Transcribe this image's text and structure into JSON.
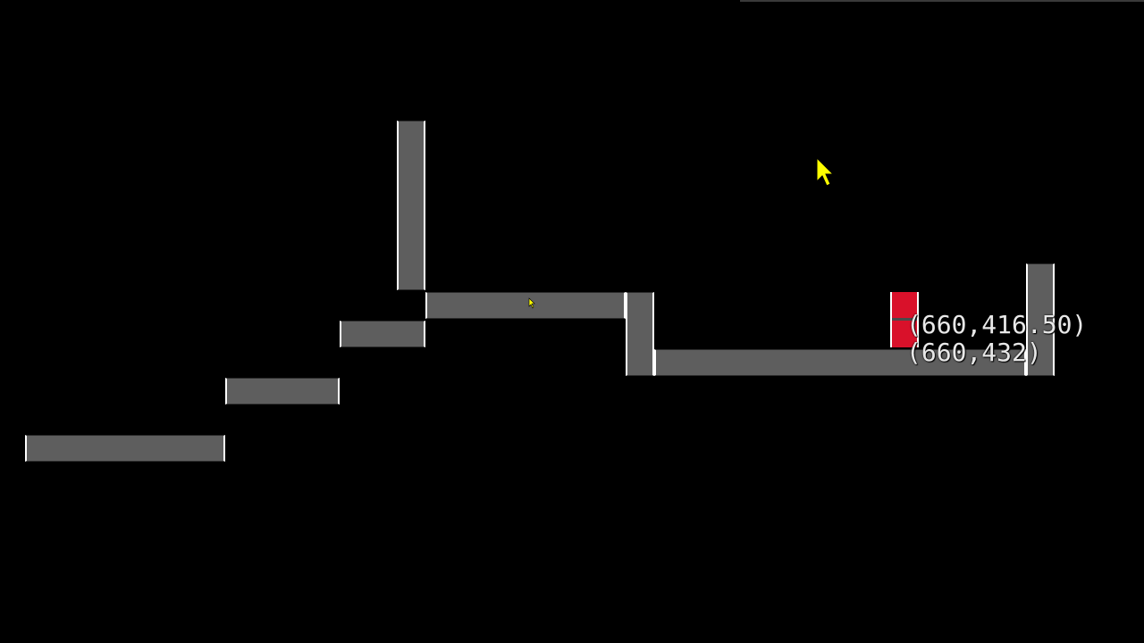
{
  "colors": {
    "background": "#000000",
    "block_fill": "#5e5e5e",
    "block_edge": "#ffffff",
    "player_fill": "#d9112a",
    "cursor": "#ffff00",
    "coord_text": "#e8e8e8"
  },
  "hud": {
    "coord_primary": "(660,416.50)",
    "coord_secondary": "(660,432)"
  },
  "icons": {
    "mouse_cursor": "arrow-cursor-icon",
    "small_cursor": "arrow-cursor-icon"
  }
}
